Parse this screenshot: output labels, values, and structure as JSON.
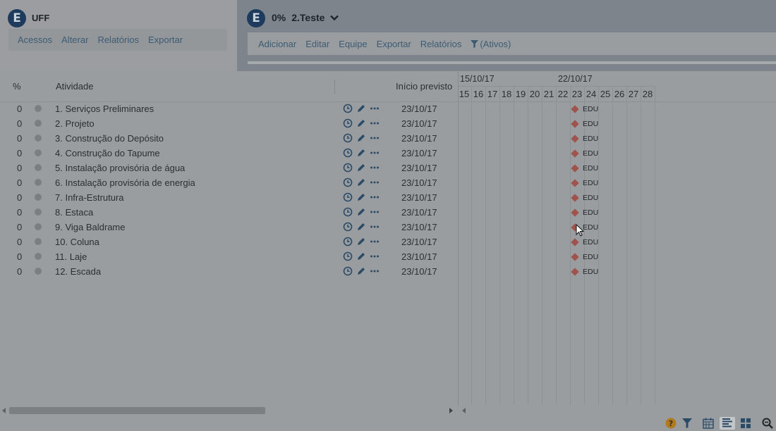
{
  "org": {
    "name": "UFF",
    "logo_letter": "E"
  },
  "left_menu": [
    "Acessos",
    "Alterar",
    "Relatórios",
    "Exportar"
  ],
  "project": {
    "percent": "0%",
    "name": "2.Teste",
    "logo_letter": "E"
  },
  "right_menu": [
    "Adicionar",
    "Editar",
    "Equipe",
    "Exportar",
    "Relatórios"
  ],
  "filter_label": "(Ativos)",
  "columns": {
    "percent": "%",
    "activity": "Atividade",
    "start": "Início previsto"
  },
  "gantt": {
    "weeks": [
      "15/10/17",
      "22/10/17"
    ],
    "days": [
      "15",
      "16",
      "17",
      "18",
      "19",
      "20",
      "21",
      "22",
      "23",
      "24",
      "25",
      "26",
      "27",
      "28"
    ],
    "milestone_label": "EDU"
  },
  "rows": [
    {
      "pct": "0",
      "name": "1. Serviços Preliminares",
      "date": "23/10/17"
    },
    {
      "pct": "0",
      "name": "2. Projeto",
      "date": "23/10/17"
    },
    {
      "pct": "0",
      "name": "3. Construção do Depósito",
      "date": "23/10/17"
    },
    {
      "pct": "0",
      "name": "4. Construção do Tapume",
      "date": "23/10/17"
    },
    {
      "pct": "0",
      "name": "5. Instalação provisória de água",
      "date": "23/10/17"
    },
    {
      "pct": "0",
      "name": "6. Instalação provisória de energia",
      "date": "23/10/17"
    },
    {
      "pct": "0",
      "name": "7. Infra-Estrutura",
      "date": "23/10/17"
    },
    {
      "pct": "0",
      "name": "8. Estaca",
      "date": "23/10/17"
    },
    {
      "pct": "0",
      "name": "9. Viga Baldrame",
      "date": "23/10/17"
    },
    {
      "pct": "0",
      "name": "10. Coluna",
      "date": "23/10/17"
    },
    {
      "pct": "0",
      "name": "11. Laje",
      "date": "23/10/17"
    },
    {
      "pct": "0",
      "name": "12. Escada",
      "date": "23/10/17"
    }
  ],
  "row_icons": [
    "clock-icon",
    "pencil-icon",
    "more-icon"
  ],
  "bottom_icons": [
    "help-icon",
    "filter-icon",
    "calendar-icon",
    "gantt-view-icon",
    "grid-view-icon",
    "zoom-icon"
  ],
  "colors": {
    "brand": "#1e3a5c",
    "link": "#3c5b73",
    "milestone": "#a0524c"
  }
}
